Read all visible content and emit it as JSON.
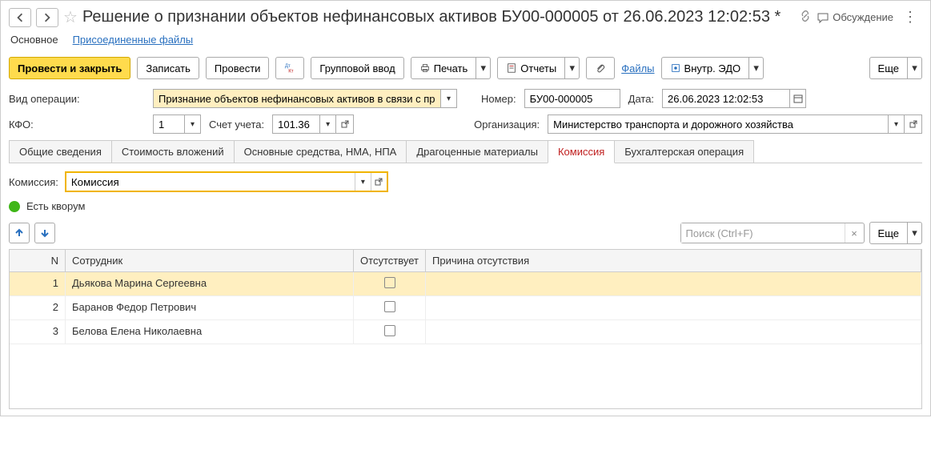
{
  "header": {
    "title": "Решение о признании объектов нефинансовых активов БУ00-000005 от 26.06.2023 12:02:53 *",
    "discussion": "Обсуждение"
  },
  "sections": {
    "main": "Основное",
    "attached": "Присоединенные файлы"
  },
  "toolbar": {
    "post_close": "Провести и закрыть",
    "save": "Записать",
    "post": "Провести",
    "group_input": "Групповой ввод",
    "print": "Печать",
    "reports": "Отчеты",
    "files": "Файлы",
    "edo": "Внутр. ЭДО",
    "more": "Еще"
  },
  "form": {
    "operation_label": "Вид операции:",
    "operation_value": "Признание объектов нефинансовых активов в связи с приоб",
    "number_label": "Номер:",
    "number_value": "БУ00-000005",
    "date_label": "Дата:",
    "date_value": "26.06.2023 12:02:53",
    "kfo_label": "КФО:",
    "kfo_value": "1",
    "account_label": "Счет учета:",
    "account_value": "101.36",
    "org_label": "Организация:",
    "org_value": "Министерство транспорта и дорожного хозяйства"
  },
  "tabs": {
    "general": "Общие сведения",
    "investments": "Стоимость вложений",
    "assets": "Основные средства, НМА, НПА",
    "precious": "Драгоценные материалы",
    "commission": "Комиссия",
    "accounting": "Бухгалтерская операция"
  },
  "commission": {
    "label": "Комиссия:",
    "value": "Комиссия",
    "quorum": "Есть кворум"
  },
  "table_toolbar": {
    "search_placeholder": "Поиск (Ctrl+F)",
    "more": "Еще"
  },
  "table": {
    "headers": {
      "n": "N",
      "employee": "Сотрудник",
      "absent": "Отсутствует",
      "reason": "Причина отсутствия"
    },
    "rows": [
      {
        "n": "1",
        "employee": "Дьякова Марина Сергеевна",
        "absent": false,
        "reason": ""
      },
      {
        "n": "2",
        "employee": "Баранов Федор Петрович",
        "absent": false,
        "reason": ""
      },
      {
        "n": "3",
        "employee": "Белова Елена Николаевна",
        "absent": false,
        "reason": ""
      }
    ]
  }
}
